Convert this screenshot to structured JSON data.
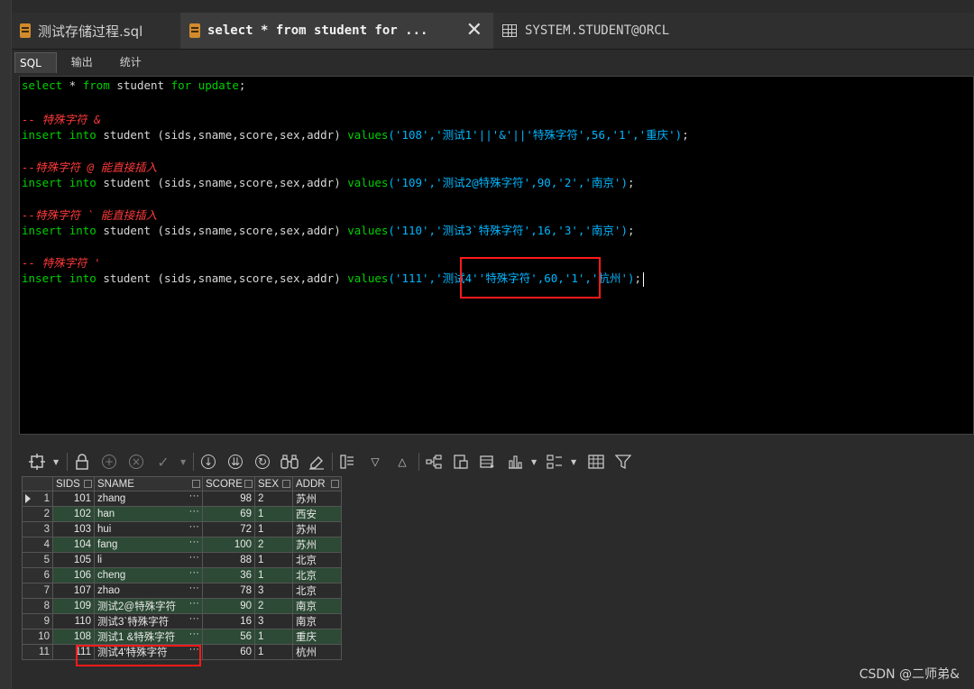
{
  "tabs": [
    {
      "label": "测试存储过程.sql",
      "icon": "sql-file-icon"
    },
    {
      "label": "select * from student for   ...",
      "icon": "sql-file-icon"
    },
    {
      "label": "SYSTEM.STUDENT@ORCL",
      "icon": "table-icon"
    }
  ],
  "subtabs": [
    "SQL",
    "输出",
    "统计"
  ],
  "editor": {
    "line1": {
      "kw1": "select",
      "mid": " * ",
      "kw2": "from",
      "mid2": " student ",
      "kw3": "for",
      "sp": " ",
      "kw4": "update",
      "end": ";"
    },
    "c1": "-- 特殊字符 &",
    "i1": {
      "pre": " student (sids,sname,score,sex,addr) ",
      "kw": "values",
      "args": "('108','测试1'||'&'||'特殊字符',56,'1','重庆')",
      "end": ";"
    },
    "c2": "--特殊字符 @ 能直接插入",
    "i2": {
      "pre": " student (sids,sname,score,sex,addr) ",
      "kw": "values",
      "args": "('109','测试2@特殊字符',90,'2','南京')",
      "end": ";"
    },
    "c3": "--特殊字符 ` 能直接插入",
    "i3": {
      "pre": " student (sids,sname,score,sex,addr) ",
      "kw": "values",
      "args": "('110','测试3`特殊字符',16,'3','南京')",
      "end": ";"
    },
    "c4": "-- 特殊字符 '",
    "i4": {
      "pre": " student (sids,sname,score,sex,addr) ",
      "kw": "values",
      "args": "('111','测试4''特殊字符',60,'1','杭州')",
      "end": ";"
    },
    "insert_kw": "insert",
    "into_kw": "into"
  },
  "grid": {
    "columns": [
      "SIDS",
      "SNAME",
      "SCORE",
      "SEX",
      "ADDR"
    ],
    "rows": [
      [
        "1",
        "101",
        "zhang",
        "98",
        "2",
        "苏州"
      ],
      [
        "2",
        "102",
        "han",
        "69",
        "1",
        "西安"
      ],
      [
        "3",
        "103",
        "hui",
        "72",
        "1",
        "苏州"
      ],
      [
        "4",
        "104",
        "fang",
        "100",
        "2",
        "苏州"
      ],
      [
        "5",
        "105",
        "li",
        "88",
        "1",
        "北京"
      ],
      [
        "6",
        "106",
        "cheng",
        "36",
        "1",
        "北京"
      ],
      [
        "7",
        "107",
        "zhao",
        "78",
        "3",
        "北京"
      ],
      [
        "8",
        "109",
        "测试2@特殊字符",
        "90",
        "2",
        "南京"
      ],
      [
        "9",
        "110",
        "测试3`特殊字符",
        "16",
        "3",
        "南京"
      ],
      [
        "10",
        "108",
        "测试1 &特殊字符",
        "56",
        "1",
        "重庆"
      ],
      [
        "11",
        "111",
        "测试4'特殊字符",
        "60",
        "1",
        "杭州"
      ]
    ],
    "cell_more": "···"
  },
  "watermark": "CSDN @二师弟&",
  "colors": {
    "keyword": "#00d000",
    "string": "#00b7ff",
    "comment": "#ff3a3a",
    "highlight": "#ff1a1a",
    "even_row": "#2c4a35"
  }
}
